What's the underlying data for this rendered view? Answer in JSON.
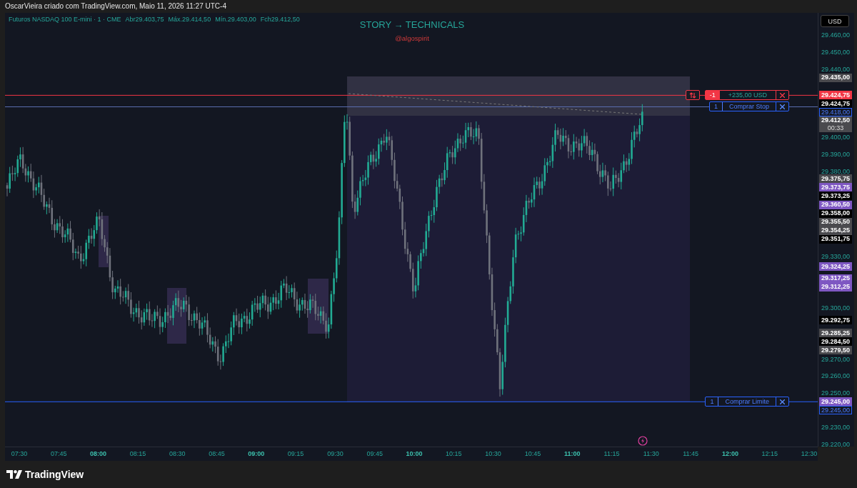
{
  "caption": "OscarVieira criado com TradingView.com, Maio 11, 2026 11:27 UTC-4",
  "legend": [
    "Futuros NASDAQ 100 E-mini · 1 · CME",
    "Abr29.403,75",
    "Máx.29.414,50",
    "Mín.29.403,00",
    "Fch29.412,50"
  ],
  "headline": "STORY → TECHNICALS",
  "author": "@algospirit",
  "currency_button": "USD",
  "price_axis": [
    "29.460,00",
    "29.450,00",
    "29.440,00",
    "29.400,00",
    "29.390,00",
    "29.380,00",
    "29.330,00",
    "29.300,00",
    "29.270,00",
    "29.260,00",
    "29.250,00",
    "29.230,00",
    "29.220,00"
  ],
  "price_tags": [
    {
      "text": "29.435,00",
      "kind": "gray"
    },
    {
      "text": "29.424,75",
      "kind": "red"
    },
    {
      "text": "29.424,75",
      "kind": "black",
      "order": {
        "kind": "position",
        "quantity": "-1",
        "label": "+235,00 USD"
      }
    },
    {
      "text": "29.418,00",
      "kind": "outline",
      "order": {
        "kind": "stop",
        "quantity": "1",
        "label": "Comprar Stop"
      }
    },
    {
      "text": "29.412,50",
      "kind": "gray",
      "timer": "00:33"
    },
    {
      "text": "29.375,75",
      "kind": "gray"
    },
    {
      "text": "29.373,75",
      "kind": "purple"
    },
    {
      "text": "29.373,25",
      "kind": "black"
    },
    {
      "text": "29.360,50",
      "kind": "purple"
    },
    {
      "text": "29.358,00",
      "kind": "black"
    },
    {
      "text": "29.355,50",
      "kind": "gray"
    },
    {
      "text": "29.354,25",
      "kind": "gray"
    },
    {
      "text": "29.351,75",
      "kind": "black"
    },
    {
      "text": "29.324,25",
      "kind": "purple"
    },
    {
      "text": "29.317,25",
      "kind": "purple"
    },
    {
      "text": "29.312,25",
      "kind": "purple"
    },
    {
      "text": "29.292,75",
      "kind": "black"
    },
    {
      "text": "29.285,25",
      "kind": "gray"
    },
    {
      "text": "29.284,50",
      "kind": "black"
    },
    {
      "text": "29.279,50",
      "kind": "gray"
    },
    {
      "text": "29.245,00",
      "kind": "purple"
    },
    {
      "text": "29.245,00",
      "kind": "outline",
      "order": {
        "kind": "limit",
        "quantity": "1",
        "label": "Comprar Limite"
      }
    }
  ],
  "time_axis": [
    {
      "label": "07:30",
      "major": false
    },
    {
      "label": "07:45",
      "major": false
    },
    {
      "label": "08:00",
      "major": true
    },
    {
      "label": "08:15",
      "major": false
    },
    {
      "label": "08:30",
      "major": false
    },
    {
      "label": "08:45",
      "major": false
    },
    {
      "label": "09:00",
      "major": true
    },
    {
      "label": "09:15",
      "major": false
    },
    {
      "label": "09:30",
      "major": false
    },
    {
      "label": "09:45",
      "major": false
    },
    {
      "label": "10:00",
      "major": true
    },
    {
      "label": "10:15",
      "major": false
    },
    {
      "label": "10:30",
      "major": false
    },
    {
      "label": "10:45",
      "major": false
    },
    {
      "label": "11:00",
      "major": true
    },
    {
      "label": "11:15",
      "major": false
    },
    {
      "label": "11:30",
      "major": false
    },
    {
      "label": "11:45",
      "major": false
    },
    {
      "label": "12:00",
      "major": true
    },
    {
      "label": "12:15",
      "major": false
    },
    {
      "label": "12:30",
      "major": false
    }
  ],
  "brand": "TradingView"
}
